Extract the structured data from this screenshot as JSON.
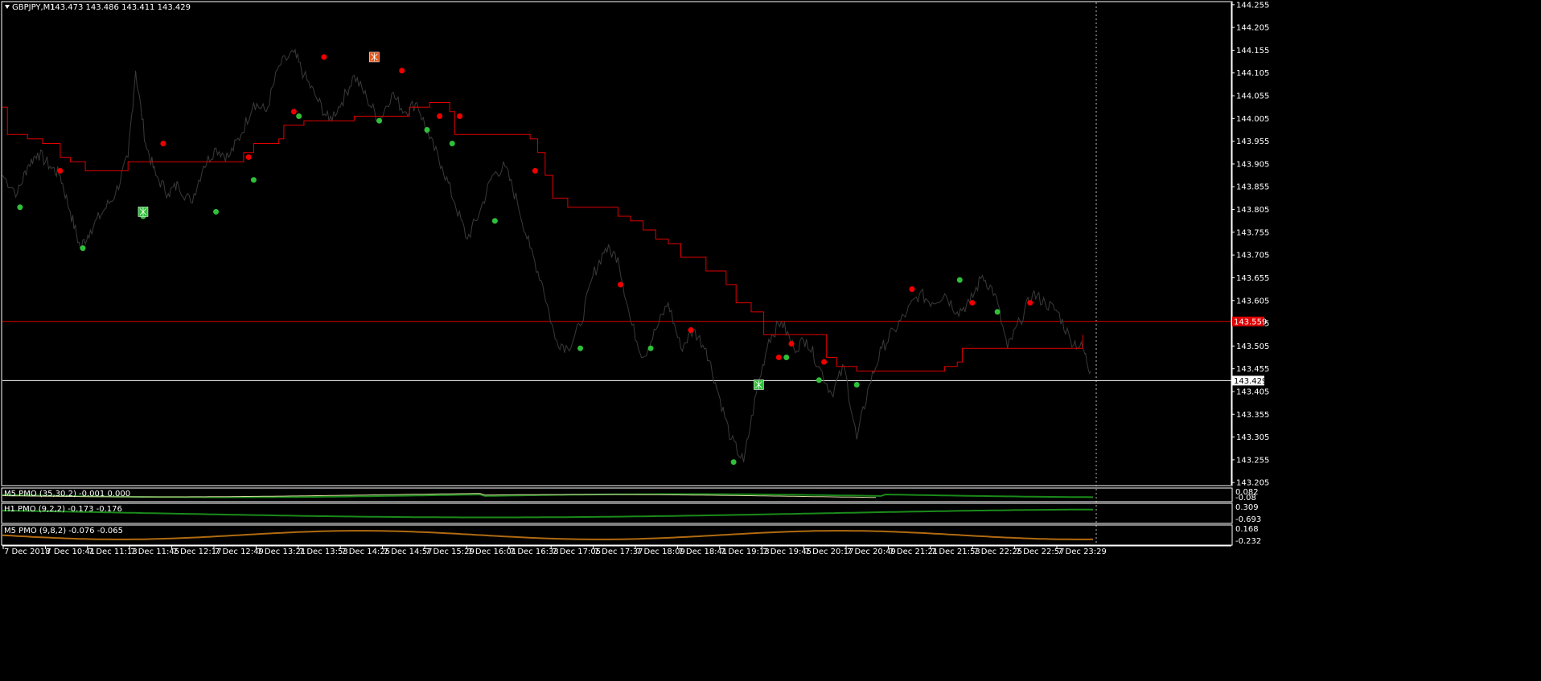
{
  "window": {
    "symbol_label": "GBPJPY,M1",
    "ohlc_label": "143.473 143.486 143.411 143.429"
  },
  "colors": {
    "background": "#000000",
    "price_line": "#3a3a3a",
    "trail_line": "#e00000",
    "buy_dot": "#2fbf3a",
    "sell_dot": "#f00000",
    "grid_frame": "#ffffff",
    "pmo_green": "#1a8a1a",
    "pmo_orange": "#b06a10"
  },
  "chart_data": {
    "type": "line",
    "y_ticks": [
      "144.255",
      "144.205",
      "144.155",
      "144.105",
      "144.055",
      "144.005",
      "143.955",
      "143.905",
      "143.855",
      "143.805",
      "143.755",
      "143.705",
      "143.655",
      "143.605",
      "143.555",
      "143.505",
      "143.455",
      "143.405",
      "143.355",
      "143.305",
      "143.255",
      "143.205"
    ],
    "ylim": [
      143.2,
      144.26
    ],
    "x_ticks": [
      "7 Dec 2018",
      "7 Dec 10:41",
      "7 Dec 11:13",
      "7 Dec 11:45",
      "7 Dec 12:17",
      "7 Dec 12:49",
      "7 Dec 13:21",
      "7 Dec 13:53",
      "7 Dec 14:25",
      "7 Dec 14:57",
      "7 Dec 15:29",
      "7 Dec 16:01",
      "7 Dec 16:33",
      "7 Dec 17:05",
      "7 Dec 17:37",
      "7 Dec 18:09",
      "7 Dec 18:41",
      "7 Dec 19:13",
      "7 Dec 19:45",
      "7 Dec 20:17",
      "7 Dec 20:49",
      "7 Dec 21:21",
      "7 Dec 21:53",
      "7 Dec 22:25",
      "7 Dec 22:57",
      "7 Dec 23:29"
    ],
    "price_series": [
      [
        0,
        143.88
      ],
      [
        0.6,
        143.84
      ],
      [
        1.0,
        143.9
      ],
      [
        1.4,
        143.93
      ],
      [
        1.9,
        143.9
      ],
      [
        2.3,
        143.88
      ],
      [
        2.7,
        143.8
      ],
      [
        3.1,
        143.72
      ],
      [
        3.5,
        143.76
      ],
      [
        4.0,
        143.8
      ],
      [
        4.5,
        143.84
      ],
      [
        5,
        143.92
      ],
      [
        5.3,
        144.11
      ],
      [
        5.7,
        143.95
      ],
      [
        6.1,
        143.88
      ],
      [
        6.6,
        143.84
      ],
      [
        7,
        143.86
      ],
      [
        7.5,
        143.82
      ],
      [
        8,
        143.9
      ],
      [
        8.5,
        143.94
      ],
      [
        9,
        143.92
      ],
      [
        9.5,
        143.97
      ],
      [
        10,
        144.04
      ],
      [
        10.5,
        144.02
      ],
      [
        11,
        144.12
      ],
      [
        11.6,
        144.15
      ],
      [
        12,
        144.1
      ],
      [
        12.5,
        144.05
      ],
      [
        13,
        144.0
      ],
      [
        13.5,
        144.04
      ],
      [
        14,
        144.1
      ],
      [
        14.5,
        144.05
      ],
      [
        15,
        144.0
      ],
      [
        15.5,
        144.06
      ],
      [
        16,
        144.02
      ],
      [
        16.5,
        144.04
      ],
      [
        17,
        143.96
      ],
      [
        17.5,
        143.9
      ],
      [
        18,
        143.82
      ],
      [
        18.5,
        143.74
      ],
      [
        19,
        143.8
      ],
      [
        19.5,
        143.88
      ],
      [
        20,
        143.9
      ],
      [
        20.5,
        143.82
      ],
      [
        21,
        143.72
      ],
      [
        21.5,
        143.64
      ],
      [
        22,
        143.52
      ],
      [
        22.5,
        143.5
      ],
      [
        23,
        143.55
      ],
      [
        23.5,
        143.66
      ],
      [
        24,
        143.72
      ],
      [
        24.5,
        143.7
      ],
      [
        25,
        143.56
      ],
      [
        25.5,
        143.48
      ],
      [
        26,
        143.54
      ],
      [
        26.5,
        143.6
      ],
      [
        27,
        143.5
      ],
      [
        27.5,
        143.54
      ],
      [
        28,
        143.5
      ],
      [
        28.5,
        143.4
      ],
      [
        29,
        143.3
      ],
      [
        29.5,
        143.25
      ],
      [
        30,
        143.4
      ],
      [
        30.5,
        143.52
      ],
      [
        31,
        143.56
      ],
      [
        31.5,
        143.5
      ],
      [
        32,
        143.52
      ],
      [
        32.5,
        143.46
      ],
      [
        33,
        143.4
      ],
      [
        33.5,
        143.46
      ],
      [
        34,
        143.3
      ],
      [
        34.5,
        143.42
      ],
      [
        35,
        143.5
      ],
      [
        35.5,
        143.54
      ],
      [
        36,
        143.58
      ],
      [
        36.5,
        143.62
      ],
      [
        37,
        143.6
      ],
      [
        37.5,
        143.62
      ],
      [
        38,
        143.58
      ],
      [
        38.5,
        143.6
      ],
      [
        39,
        143.66
      ],
      [
        39.5,
        143.62
      ],
      [
        40,
        143.5
      ],
      [
        40.5,
        143.56
      ],
      [
        41,
        143.62
      ],
      [
        41.5,
        143.6
      ],
      [
        42,
        143.58
      ],
      [
        42.5,
        143.52
      ],
      [
        43,
        143.5
      ],
      [
        43.3,
        143.45
      ]
    ],
    "trail_series": [
      [
        0,
        144.03
      ],
      [
        0.2,
        143.97
      ],
      [
        1.0,
        143.96
      ],
      [
        1.6,
        143.95
      ],
      [
        2.3,
        143.92
      ],
      [
        2.7,
        143.91
      ],
      [
        3.3,
        143.89
      ],
      [
        5.0,
        143.89
      ],
      [
        5.0,
        143.91
      ],
      [
        7.0,
        143.91
      ],
      [
        9.2,
        143.91
      ],
      [
        9.6,
        143.93
      ],
      [
        10,
        143.95
      ],
      [
        11,
        143.96
      ],
      [
        11.2,
        143.99
      ],
      [
        12,
        144.0
      ],
      [
        14,
        144.01
      ],
      [
        16,
        144.01
      ],
      [
        16.2,
        144.03
      ],
      [
        17,
        144.04
      ],
      [
        17.6,
        144.04
      ],
      [
        17.8,
        144.02
      ],
      [
        18,
        143.97
      ],
      [
        20,
        143.97
      ],
      [
        21,
        143.96
      ],
      [
        21.3,
        143.93
      ],
      [
        21.6,
        143.88
      ],
      [
        21.9,
        143.83
      ],
      [
        22.5,
        143.81
      ],
      [
        24,
        143.81
      ],
      [
        24.5,
        143.79
      ],
      [
        25,
        143.78
      ],
      [
        25.5,
        143.76
      ],
      [
        26,
        143.74
      ],
      [
        26.5,
        143.73
      ],
      [
        27,
        143.7
      ],
      [
        28,
        143.67
      ],
      [
        28.8,
        143.64
      ],
      [
        29.2,
        143.6
      ],
      [
        29.8,
        143.58
      ],
      [
        30.3,
        143.53
      ],
      [
        32.5,
        143.53
      ],
      [
        32.8,
        143.48
      ],
      [
        33.2,
        143.46
      ],
      [
        34,
        143.45
      ],
      [
        37,
        143.45
      ],
      [
        37.5,
        143.46
      ],
      [
        38,
        143.47
      ],
      [
        38.2,
        143.5
      ],
      [
        40,
        143.5
      ],
      [
        42,
        143.5
      ],
      [
        42.5,
        143.5
      ],
      [
        43,
        143.53
      ]
    ],
    "buy_signals": [
      [
        0.7,
        143.81
      ],
      [
        3.2,
        143.72
      ],
      [
        5.6,
        143.79
      ],
      [
        8.5,
        143.8
      ],
      [
        10.0,
        143.87
      ],
      [
        11.8,
        144.01
      ],
      [
        15.0,
        144.0
      ],
      [
        16.9,
        143.98
      ],
      [
        17.9,
        143.95
      ],
      [
        19.6,
        143.78
      ],
      [
        23.0,
        143.5
      ],
      [
        25.8,
        143.5
      ],
      [
        29.1,
        143.25
      ],
      [
        31.2,
        143.48
      ],
      [
        32.5,
        143.43
      ],
      [
        34.0,
        143.42
      ],
      [
        38.1,
        143.65
      ],
      [
        39.6,
        143.58
      ]
    ],
    "sell_signals": [
      [
        2.3,
        143.89
      ],
      [
        6.4,
        143.95
      ],
      [
        9.8,
        143.92
      ],
      [
        11.6,
        144.02
      ],
      [
        12.8,
        144.14
      ],
      [
        15.9,
        144.11
      ],
      [
        17.4,
        144.01
      ],
      [
        18.2,
        144.01
      ],
      [
        21.2,
        143.89
      ],
      [
        24.6,
        143.64
      ],
      [
        27.4,
        143.54
      ],
      [
        30.9,
        143.48
      ],
      [
        31.4,
        143.51
      ],
      [
        32.7,
        143.47
      ],
      [
        36.2,
        143.63
      ],
      [
        38.6,
        143.6
      ],
      [
        40.9,
        143.6
      ]
    ],
    "buy_arrows": [
      [
        5.6,
        143.8
      ],
      [
        30.1,
        143.42
      ]
    ],
    "sell_arrows": [
      [
        14.8,
        144.14
      ]
    ],
    "x_range": [
      0,
      43.5
    ],
    "bid_price": "143.429",
    "alert_price": "143.559",
    "alert_price_value": 143.559,
    "bid_price_value": 143.429,
    "grid": false
  },
  "subwindows": [
    {
      "label": "M5 PMO (35,30,2) -0.001 0.000",
      "scale_top": "0.082",
      "scale_bottom": "-0.08",
      "color": "#1a8a1a"
    },
    {
      "label": "H1 PMO (9,2,2) -0.173 -0.176",
      "scale_top": "0.309",
      "scale_bottom": "-0.693",
      "color": "#1a8a1a"
    },
    {
      "label": "M5 PMO (9,8,2) -0.076 -0.065",
      "scale_top": "0.168",
      "scale_bottom": "-0.232",
      "color": "#b06a10"
    }
  ]
}
